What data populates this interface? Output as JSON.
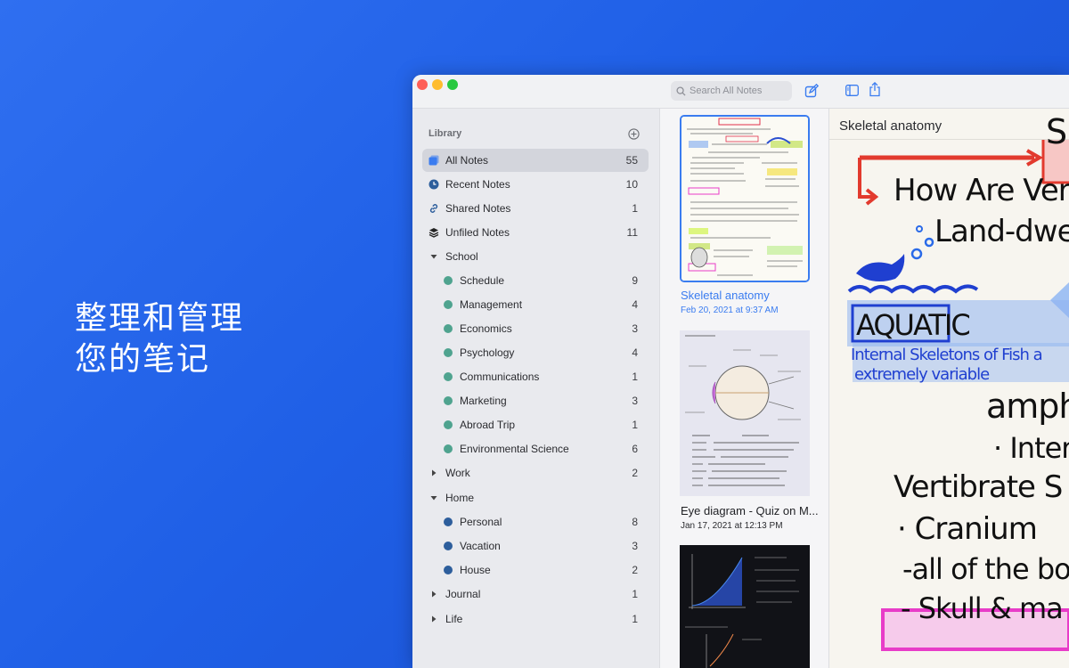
{
  "promo": {
    "line1": "整理和管理",
    "line2": "您的笔记"
  },
  "toolbar": {
    "search_placeholder": "Search All Notes"
  },
  "sidebar": {
    "header": "Library",
    "items": [
      {
        "label": "All Notes",
        "count": "55"
      },
      {
        "label": "Recent Notes",
        "count": "10"
      },
      {
        "label": "Shared Notes",
        "count": "1"
      },
      {
        "label": "Unfiled Notes",
        "count": "11"
      },
      {
        "label": "School",
        "count": ""
      },
      {
        "label": "Schedule",
        "count": "9"
      },
      {
        "label": "Management",
        "count": "4"
      },
      {
        "label": "Economics",
        "count": "3"
      },
      {
        "label": "Psychology",
        "count": "4"
      },
      {
        "label": "Communications",
        "count": "1"
      },
      {
        "label": "Marketing",
        "count": "3"
      },
      {
        "label": "Abroad Trip",
        "count": "1"
      },
      {
        "label": "Environmental Science",
        "count": "6"
      },
      {
        "label": "Work",
        "count": "2"
      },
      {
        "label": "Home",
        "count": ""
      },
      {
        "label": "Personal",
        "count": "8"
      },
      {
        "label": "Vacation",
        "count": "3"
      },
      {
        "label": "House",
        "count": "2"
      },
      {
        "label": "Journal",
        "count": "1"
      },
      {
        "label": "Life",
        "count": "1"
      }
    ]
  },
  "notes": [
    {
      "title": "Skeletal anatomy",
      "date": "Feb 20, 2021 at 9:37 AM"
    },
    {
      "title": "Eye diagram - Quiz on M...",
      "date": "Jan 17, 2021 at 12:13 PM"
    }
  ],
  "editor": {
    "title": "Skeletal anatomy",
    "lines": [
      "S",
      "How Are Vertib",
      "Land-dwell",
      "AQUATIC",
      "Internal Skeletons of Fish a",
      "extremely variable",
      "amph",
      "· Intern",
      "Vertibrate S",
      "· Cranium",
      "-all of the bon",
      "- Skull & ma"
    ]
  },
  "colors": {
    "accent": "#3a7cf0",
    "school_dot": "#4fa38f",
    "home_dot": "#2d5e9c"
  }
}
